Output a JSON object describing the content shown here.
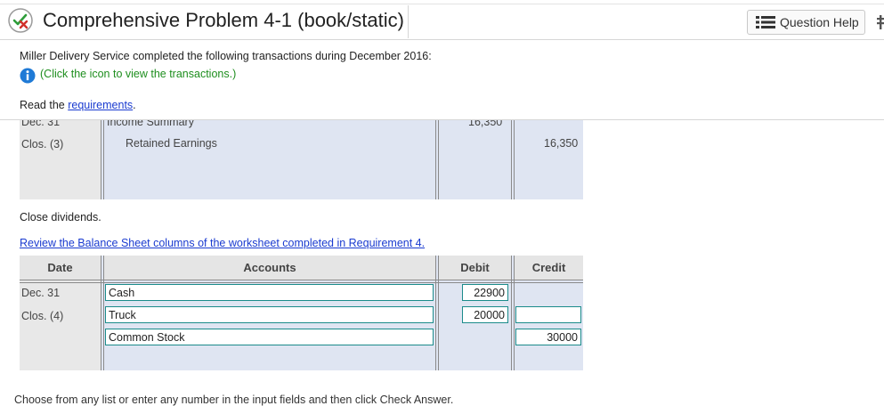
{
  "header": {
    "title": "Comprehensive Problem 4-1 (book/static)",
    "question_help_label": "Question Help"
  },
  "intro": {
    "text": "Miller Delivery Service completed the following transactions during December 2016:",
    "click_note": "(Click the icon to view the transactions.)",
    "read_prefix": "Read the ",
    "requirements_link": "requirements",
    "read_suffix": "."
  },
  "closing_entry_3": {
    "date": "Dec. 31",
    "ref": "Clos. (3)",
    "rows": [
      {
        "account": "Income Summary",
        "debit": "16,350",
        "credit": ""
      },
      {
        "account": "Retained Earnings",
        "debit": "",
        "credit": "16,350"
      }
    ]
  },
  "close_dividends": {
    "label": "Close dividends.",
    "review_link": "Review the Balance Sheet columns of the worksheet completed in Requirement 4.",
    "columns": {
      "date": "Date",
      "accounts": "Accounts",
      "debit": "Debit",
      "credit": "Credit"
    },
    "date": "Dec. 31",
    "ref": "Clos. (4)",
    "rows": [
      {
        "account": "Cash",
        "debit": "22900",
        "credit": ""
      },
      {
        "account": "Truck",
        "debit": "20000",
        "credit": ""
      },
      {
        "account": "Common Stock",
        "debit": "",
        "credit": "30000"
      }
    ]
  },
  "footer": {
    "instruction": "Choose from any list or enter any number in the input fields and then click Check Answer."
  },
  "colors": {
    "table_bg": "#dfe5f2",
    "date_col_bg": "#e8e8e8",
    "field_border": "#1b8b8b",
    "link": "#1a3bd0",
    "note_green": "#1e8e1e",
    "icon_red": "#d0302a",
    "info_blue": "#1f7ad6"
  },
  "icons": {
    "title_icon": "partial-credit-icon",
    "help_icon": "list-icon",
    "info_icon": "info-icon",
    "more_icon": "more-icon"
  }
}
